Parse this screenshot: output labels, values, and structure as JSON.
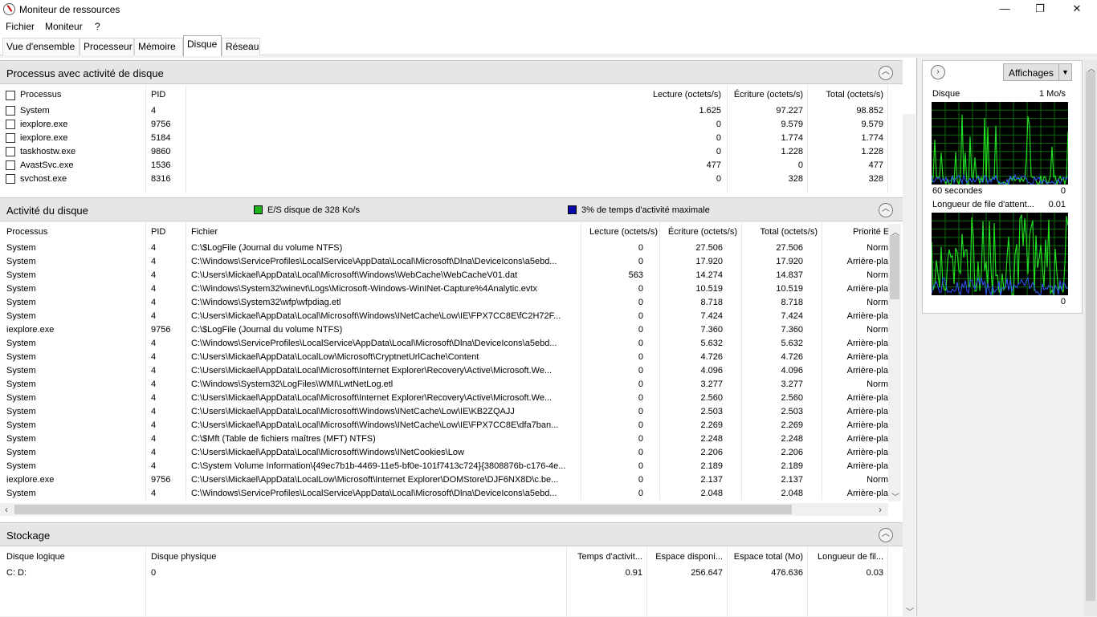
{
  "window": {
    "title": "Moniteur de ressources",
    "minimize": "—",
    "maximize": "❐",
    "close": "✕"
  },
  "menu": [
    "Fichier",
    "Moniteur",
    "?"
  ],
  "tabs": [
    "Vue d'ensemble",
    "Processeur",
    "Mémoire",
    "Disque",
    "Réseau"
  ],
  "active_tab": "Disque",
  "processes_panel": {
    "title": "Processus avec activité de disque",
    "columns": [
      "Processus",
      "PID",
      "Lecture (octets/s)",
      "Écriture (octets/s)",
      "Total (octets/s)"
    ],
    "rows": [
      [
        "System",
        "4",
        "1.625",
        "97.227",
        "98.852"
      ],
      [
        "iexplore.exe",
        "9756",
        "0",
        "9.579",
        "9.579"
      ],
      [
        "iexplore.exe",
        "5184",
        "0",
        "1.774",
        "1.774"
      ],
      [
        "taskhostw.exe",
        "9860",
        "0",
        "1.228",
        "1.228"
      ],
      [
        "AvastSvc.exe",
        "1536",
        "477",
        "0",
        "477"
      ],
      [
        "svchost.exe",
        "8316",
        "0",
        "328",
        "328"
      ]
    ]
  },
  "disk_activity_panel": {
    "title": "Activité du disque",
    "legend_io": "E/S disque de 328 Ko/s",
    "legend_active": "3% de temps d'activité maximale",
    "legend_io_color": "#1db31d",
    "legend_active_color": "#0a0aa8",
    "columns": [
      "Processus",
      "PID",
      "Fichier",
      "Lecture (octets/s)",
      "Écriture (octets/s)",
      "Total (octets/s)",
      "Priorité E"
    ],
    "rows": [
      [
        "System",
        "4",
        "C:\\$LogFile (Journal du volume NTFS)",
        "0",
        "27.506",
        "27.506",
        "Norm"
      ],
      [
        "System",
        "4",
        "C:\\Windows\\ServiceProfiles\\LocalService\\AppData\\Local\\Microsoft\\Dlna\\DeviceIcons\\a5ebd...",
        "0",
        "17.920",
        "17.920",
        "Arrière-pla"
      ],
      [
        "System",
        "4",
        "C:\\Users\\Mickael\\AppData\\Local\\Microsoft\\Windows\\WebCache\\WebCacheV01.dat",
        "563",
        "14.274",
        "14.837",
        "Norm"
      ],
      [
        "System",
        "4",
        "C:\\Windows\\System32\\winevt\\Logs\\Microsoft-Windows-WinINet-Capture%4Analytic.evtx",
        "0",
        "10.519",
        "10.519",
        "Arrière-pla"
      ],
      [
        "System",
        "4",
        "C:\\Windows\\System32\\wfp\\wfpdiag.etl",
        "0",
        "8.718",
        "8.718",
        "Norm"
      ],
      [
        "System",
        "4",
        "C:\\Users\\Mickael\\AppData\\Local\\Microsoft\\Windows\\INetCache\\Low\\IE\\FPX7CC8E\\fC2H72F...",
        "0",
        "7.424",
        "7.424",
        "Arrière-pla"
      ],
      [
        "iexplore.exe",
        "9756",
        "C:\\$LogFile (Journal du volume NTFS)",
        "0",
        "7.360",
        "7.360",
        "Norm"
      ],
      [
        "System",
        "4",
        "C:\\Windows\\ServiceProfiles\\LocalService\\AppData\\Local\\Microsoft\\Dlna\\DeviceIcons\\a5ebd...",
        "0",
        "5.632",
        "5.632",
        "Arrière-pla"
      ],
      [
        "System",
        "4",
        "C:\\Users\\Mickael\\AppData\\LocalLow\\Microsoft\\CryptnetUrlCache\\Content",
        "0",
        "4.726",
        "4.726",
        "Arrière-pla"
      ],
      [
        "System",
        "4",
        "C:\\Users\\Mickael\\AppData\\Local\\Microsoft\\Internet Explorer\\Recovery\\Active\\Microsoft.We...",
        "0",
        "4.096",
        "4.096",
        "Arrière-pla"
      ],
      [
        "System",
        "4",
        "C:\\Windows\\System32\\LogFiles\\WMI\\LwtNetLog.etl",
        "0",
        "3.277",
        "3.277",
        "Norm"
      ],
      [
        "System",
        "4",
        "C:\\Users\\Mickael\\AppData\\Local\\Microsoft\\Internet Explorer\\Recovery\\Active\\Microsoft.We...",
        "0",
        "2.560",
        "2.560",
        "Arrière-pla"
      ],
      [
        "System",
        "4",
        "C:\\Users\\Mickael\\AppData\\Local\\Microsoft\\Windows\\INetCache\\Low\\IE\\KB2ZQAJJ",
        "0",
        "2.503",
        "2.503",
        "Arrière-pla"
      ],
      [
        "System",
        "4",
        "C:\\Users\\Mickael\\AppData\\Local\\Microsoft\\Windows\\INetCache\\Low\\IE\\FPX7CC8E\\dfa7ban...",
        "0",
        "2.269",
        "2.269",
        "Arrière-pla"
      ],
      [
        "System",
        "4",
        "C:\\$Mft (Table de fichiers maîtres (MFT) NTFS)",
        "0",
        "2.248",
        "2.248",
        "Arrière-pla"
      ],
      [
        "System",
        "4",
        "C:\\Users\\Mickael\\AppData\\Local\\Microsoft\\Windows\\INetCookies\\Low",
        "0",
        "2.206",
        "2.206",
        "Arrière-pla"
      ],
      [
        "System",
        "4",
        "C:\\System Volume Information\\{49ec7b1b-4469-11e5-bf0e-101f7413c724}{3808876b-c176-4e...",
        "0",
        "2.189",
        "2.189",
        "Arrière-pla"
      ],
      [
        "iexplore.exe",
        "9756",
        "C:\\Users\\Mickael\\AppData\\LocalLow\\Microsoft\\Internet Explorer\\DOMStore\\DJF6NX8D\\c.be...",
        "0",
        "2.137",
        "2.137",
        "Norm"
      ],
      [
        "System",
        "4",
        "C:\\Windows\\ServiceProfiles\\LocalService\\AppData\\Local\\Microsoft\\Dlna\\DeviceIcons\\a5ebd...",
        "0",
        "2.048",
        "2.048",
        "Arrière-pla"
      ]
    ]
  },
  "storage_panel": {
    "title": "Stockage",
    "columns": [
      "Disque logique",
      "Disque physique",
      "Temps d'activit...",
      "Espace disponi...",
      "Espace total (Mo)",
      "Longueur de fil..."
    ],
    "rows": [
      [
        "C: D:",
        "0",
        "0.91",
        "256.647",
        "476.636",
        "0.03"
      ]
    ]
  },
  "side_panel": {
    "views_label": "Affichages",
    "graph1": {
      "title": "Disque",
      "max": "1 Mo/s",
      "duration": "60 secondes",
      "min": "0"
    },
    "graph2": {
      "title": "Longueur de file d'attent...",
      "max": "0.01",
      "min": "0"
    }
  }
}
